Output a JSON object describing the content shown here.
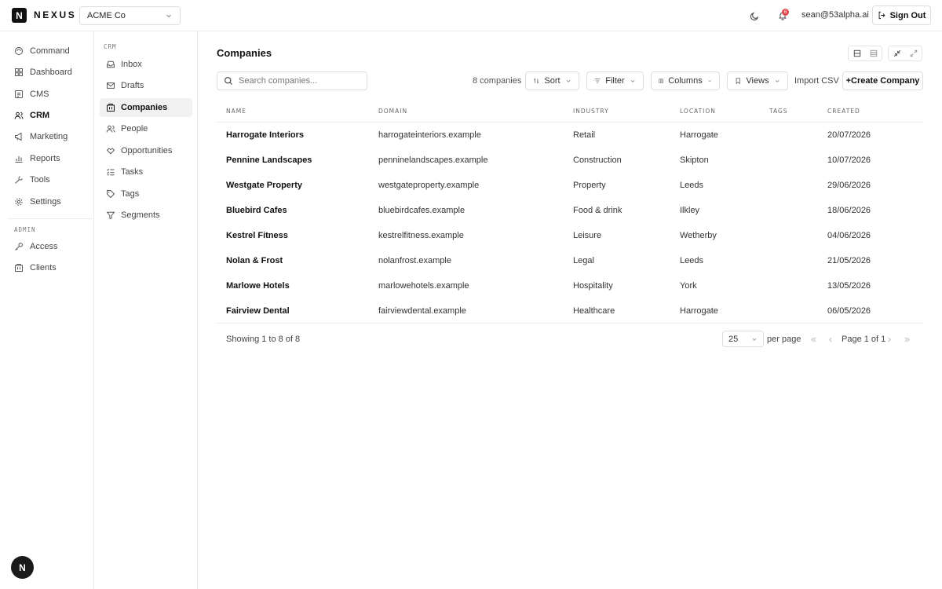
{
  "app": {
    "logo_letter": "N",
    "name": "NEXUS",
    "org": "ACME Co"
  },
  "topbar": {
    "notifications_count": "6",
    "user_email": "sean@53alpha.ai",
    "signout_label": "Sign Out"
  },
  "sidebar": {
    "items": [
      {
        "label": "Command",
        "icon": "command-icon"
      },
      {
        "label": "Dashboard",
        "icon": "dashboard-icon"
      },
      {
        "label": "CMS",
        "icon": "cms-icon"
      },
      {
        "label": "CRM",
        "icon": "users-icon",
        "active": true
      },
      {
        "label": "Marketing",
        "icon": "megaphone-icon"
      },
      {
        "label": "Reports",
        "icon": "chart-icon"
      },
      {
        "label": "Tools",
        "icon": "wrench-icon"
      },
      {
        "label": "Settings",
        "icon": "gear-icon"
      }
    ],
    "admin_label": "ADMIN",
    "admin_items": [
      {
        "label": "Access",
        "icon": "key-icon"
      },
      {
        "label": "Clients",
        "icon": "building-icon"
      }
    ],
    "avatar_letter": "N"
  },
  "subsidebar": {
    "section_label": "CRM",
    "items": [
      {
        "label": "Inbox",
        "icon": "inbox-icon"
      },
      {
        "label": "Drafts",
        "icon": "mail-icon"
      },
      {
        "label": "Companies",
        "icon": "building-icon",
        "active": true
      },
      {
        "label": "People",
        "icon": "people-icon"
      },
      {
        "label": "Opportunities",
        "icon": "handshake-icon"
      },
      {
        "label": "Tasks",
        "icon": "list-icon"
      },
      {
        "label": "Tags",
        "icon": "tag-icon"
      },
      {
        "label": "Segments",
        "icon": "funnel-icon"
      }
    ]
  },
  "main": {
    "title": "Companies",
    "search_placeholder": "Search companies...",
    "count_label": "8 companies",
    "sort_label": "Sort",
    "filter_label": "Filter",
    "columns_label": "Columns",
    "views_label": "Views",
    "import_label": "Import CSV",
    "create_label": "+Create Company"
  },
  "table": {
    "headers": [
      "NAME",
      "DOMAIN",
      "INDUSTRY",
      "LOCATION",
      "TAGS",
      "CREATED"
    ],
    "rows": [
      {
        "name": "Harrogate Interiors",
        "domain": "harrogateinteriors.example",
        "industry": "Retail",
        "location": "Harrogate",
        "tags": "",
        "created": "20/07/2026"
      },
      {
        "name": "Pennine Landscapes",
        "domain": "penninelandscapes.example",
        "industry": "Construction",
        "location": "Skipton",
        "tags": "",
        "created": "10/07/2026"
      },
      {
        "name": "Westgate Property",
        "domain": "westgateproperty.example",
        "industry": "Property",
        "location": "Leeds",
        "tags": "",
        "created": "29/06/2026"
      },
      {
        "name": "Bluebird Cafes",
        "domain": "bluebirdcafes.example",
        "industry": "Food & drink",
        "location": "Ilkley",
        "tags": "",
        "created": "18/06/2026"
      },
      {
        "name": "Kestrel Fitness",
        "domain": "kestrelfitness.example",
        "industry": "Leisure",
        "location": "Wetherby",
        "tags": "",
        "created": "04/06/2026"
      },
      {
        "name": "Nolan & Frost",
        "domain": "nolanfrost.example",
        "industry": "Legal",
        "location": "Leeds",
        "tags": "",
        "created": "21/05/2026"
      },
      {
        "name": "Marlowe Hotels",
        "domain": "marlowehotels.example",
        "industry": "Hospitality",
        "location": "York",
        "tags": "",
        "created": "13/05/2026"
      },
      {
        "name": "Fairview Dental",
        "domain": "fairviewdental.example",
        "industry": "Healthcare",
        "location": "Harrogate",
        "tags": "",
        "created": "06/05/2026"
      }
    ]
  },
  "pagination": {
    "showing": "Showing 1 to 8 of 8",
    "per_page_value": "25",
    "per_page_label": "per page",
    "page_info": "Page 1 of 1"
  },
  "colors": {
    "accent": "#111111",
    "badge": "#e5484d",
    "border": "#ebebeb"
  }
}
